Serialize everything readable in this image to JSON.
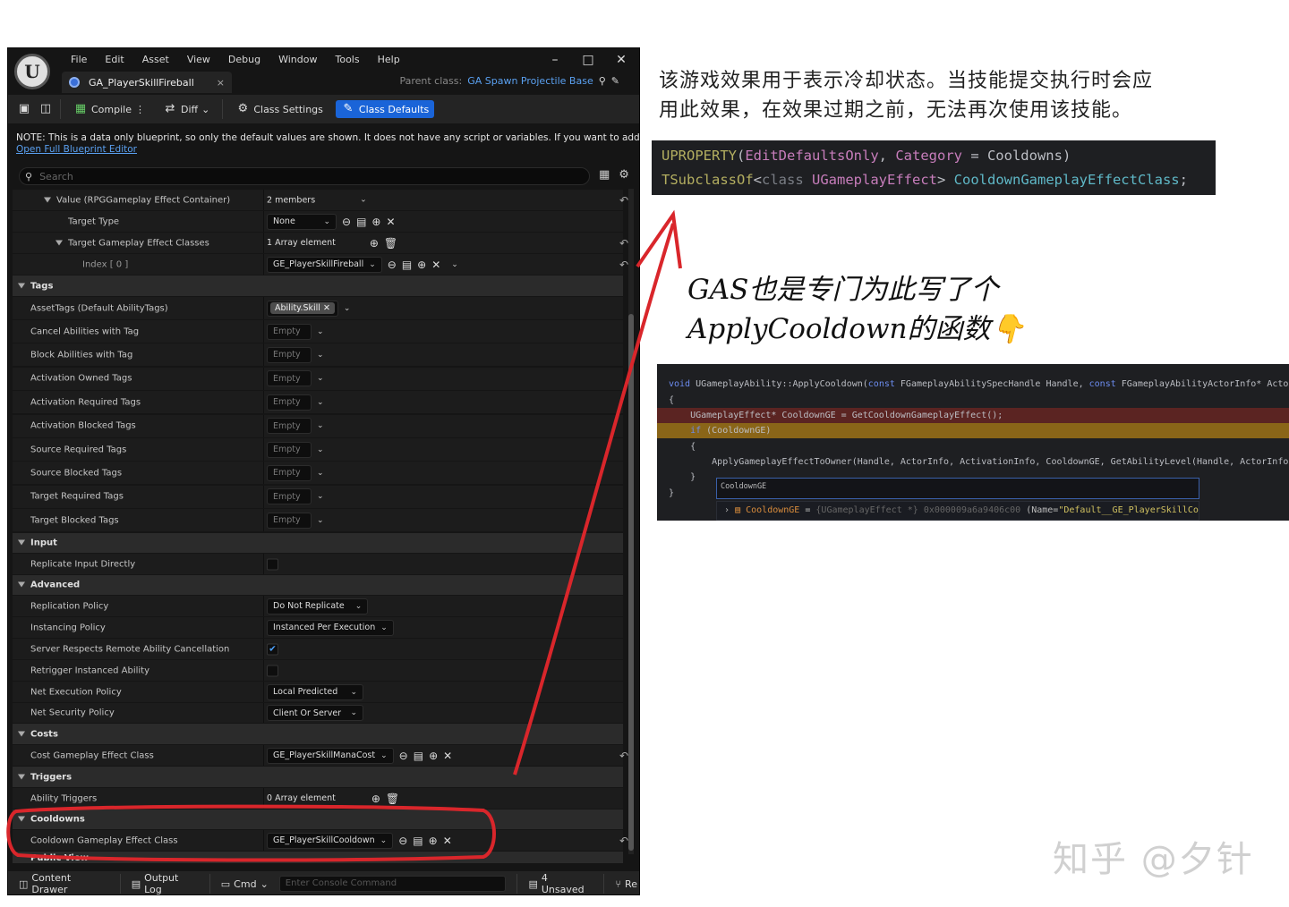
{
  "editor": {
    "menu": [
      "File",
      "Edit",
      "Asset",
      "View",
      "Debug",
      "Window",
      "Tools",
      "Help"
    ],
    "tab_title": "GA_PlayerSkillFireball",
    "tab_close": "×",
    "parent_label": "Parent class:",
    "parent_value": "GA Spawn Projectile Base",
    "toolbar": {
      "compile": "Compile",
      "diff": "Diff",
      "class_settings": "Class Settings",
      "class_defaults": "Class Defaults"
    },
    "note": "NOTE: This is a data only blueprint, so only the default values are shown.  It does not have any script or variables.  If you want to add som",
    "note_link": "Open Full Blueprint Editor",
    "search_placeholder": "Search",
    "rows": {
      "value_container": {
        "label": "Value (RPGGameplay Effect Container)",
        "value": "2 members"
      },
      "target_type": {
        "label": "Target Type",
        "value": "None"
      },
      "target_effect_classes": {
        "label": "Target Gameplay Effect Classes",
        "value": "1 Array element"
      },
      "index0": {
        "label": "Index [ 0 ]",
        "value": "GE_PlayerSkillFireball"
      },
      "tags": {
        "label": "Tags"
      },
      "asset_tags": {
        "label": "AssetTags (Default AbilityTags)",
        "value": "Ability.Skill"
      },
      "tag_rows": [
        {
          "label": "Cancel Abilities with Tag",
          "value": "Empty"
        },
        {
          "label": "Block Abilities with Tag",
          "value": "Empty"
        },
        {
          "label": "Activation Owned Tags",
          "value": "Empty"
        },
        {
          "label": "Activation Required Tags",
          "value": "Empty"
        },
        {
          "label": "Activation Blocked Tags",
          "value": "Empty"
        },
        {
          "label": "Source Required Tags",
          "value": "Empty"
        },
        {
          "label": "Source Blocked Tags",
          "value": "Empty"
        },
        {
          "label": "Target Required Tags",
          "value": "Empty"
        },
        {
          "label": "Target Blocked Tags",
          "value": "Empty"
        }
      ],
      "input": {
        "label": "Input"
      },
      "replicate_input": {
        "label": "Replicate Input Directly"
      },
      "advanced": {
        "label": "Advanced"
      },
      "replication_policy": {
        "label": "Replication Policy",
        "value": "Do Not Replicate"
      },
      "instancing_policy": {
        "label": "Instancing Policy",
        "value": "Instanced Per Execution"
      },
      "server_respects": {
        "label": "Server Respects Remote Ability Cancellation",
        "checked": true
      },
      "retrigger": {
        "label": "Retrigger Instanced Ability",
        "checked": false
      },
      "net_exec": {
        "label": "Net Execution Policy",
        "value": "Local Predicted"
      },
      "net_security": {
        "label": "Net Security Policy",
        "value": "Client Or Server"
      },
      "costs": {
        "label": "Costs"
      },
      "cost_class": {
        "label": "Cost Gameplay Effect Class",
        "value": "GE_PlayerSkillManaCost"
      },
      "triggers": {
        "label": "Triggers"
      },
      "ability_triggers": {
        "label": "Ability Triggers",
        "value": "0 Array element"
      },
      "cooldowns": {
        "label": "Cooldowns"
      },
      "cooldown_class": {
        "label": "Cooldown Gameplay Effect Class",
        "value": "GE_PlayerSkillCooldown"
      },
      "public_view": {
        "label": "Public View"
      }
    },
    "status": {
      "content_drawer": "Content Drawer",
      "output_log": "Output Log",
      "cmd": "Cmd",
      "console_placeholder": "Enter Console Command",
      "unsaved": "4 Unsaved",
      "revision": "Re"
    }
  },
  "caption1": [
    "该游戏效果用于表示冷却状态。当技能提交执行时会应",
    "用此效果，在效果过期之前，无法再次使用该技能。"
  ],
  "code1": {
    "line1": {
      "macro": "UPROPERTY",
      "open": "(",
      "a": "EditDefaultsOnly",
      "comma": ", ",
      "b": "Category",
      "eq": " = Cooldowns)"
    },
    "line2": {
      "tmpl": "TSubclassOf",
      "lt": "<",
      "cls": "class",
      "sp": " ",
      "type": "UGameplayEffect",
      "gt": "> ",
      "name": "CooldownGameplayEffectClass",
      "semi": ";"
    }
  },
  "caption2": [
    "GAS也是专门为此写了个",
    "ApplyCooldown的函数👇"
  ],
  "code2": {
    "l1_kw": "void",
    "l1_a": " UGameplayAbility::ApplyCooldown(",
    "l1_kw2": "const",
    "l1_b": " FGameplayAbilitySpecHandle Handle, ",
    "l1_kw3": "const",
    "l1_c": " FGameplayAbilityActorInfo* Actor",
    "l2": "{",
    "l3": "    UGameplayEffect* CooldownGE = GetCooldownGameplayEffect();",
    "l4_kw": "    if",
    "l4_b": " (CooldownGE)",
    "l5": "    {",
    "l6": "        ApplyGameplayEffectToOwner(Handle, ActorInfo, ActivationInfo, CooldownGE, GetAbilityLevel(Handle, ActorInfo)",
    "l7": "    }",
    "l8": "}",
    "watch_input": "CooldownGE",
    "watch_name": "CooldownGE",
    "watch_eq": " = ",
    "watch_type": "{UGameplayEffect *} 0x000009a6a9406c00",
    "watch_rest": " (Name=",
    "watch_str": "\"Default__GE_PlayerSkillCooldown_C\""
  },
  "watermark": "知乎 @夕针",
  "colors": {
    "accent": "#1a64d8",
    "annotation": "#d9262b"
  }
}
